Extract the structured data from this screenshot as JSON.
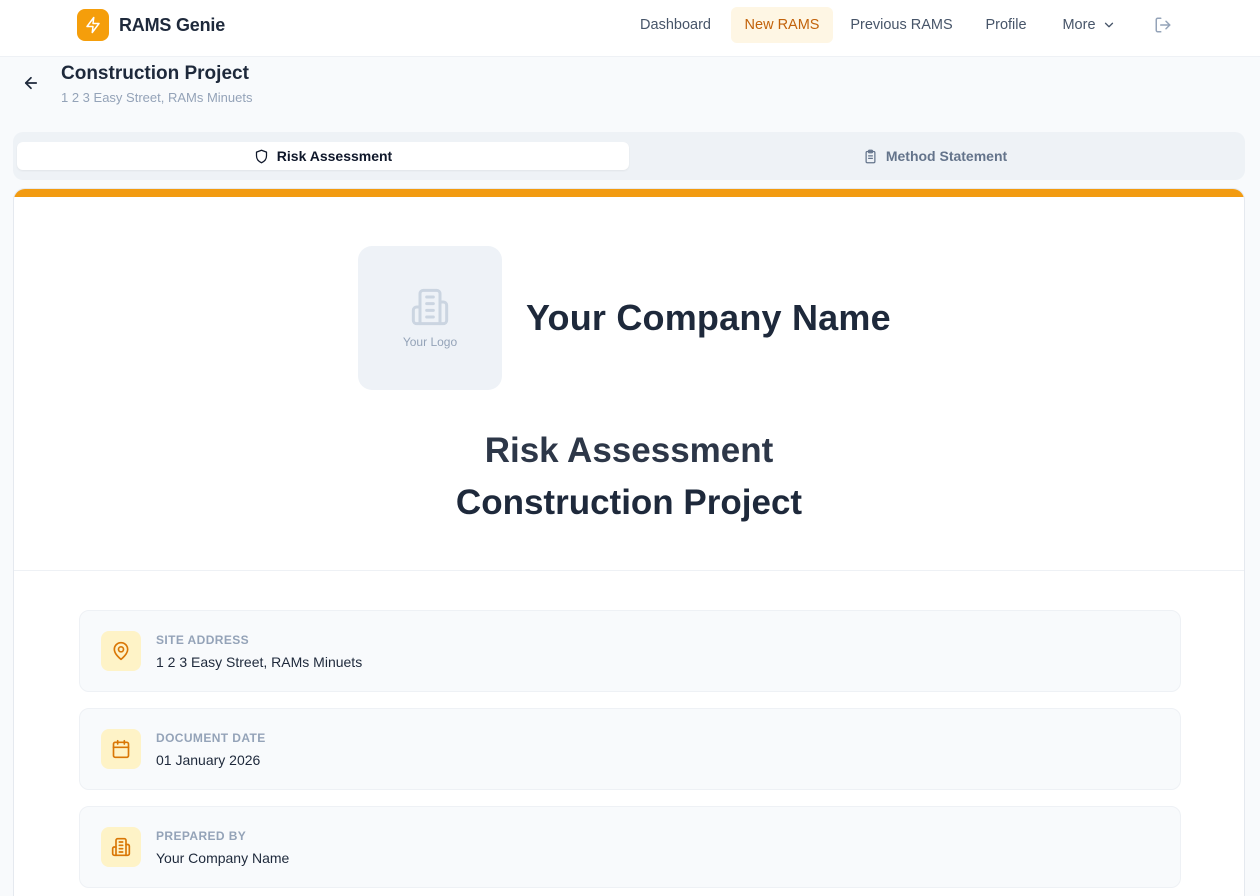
{
  "app": {
    "name": "RAMS Genie",
    "logo_icon": "lightning-icon",
    "accent": "#f59e0b"
  },
  "nav": {
    "items": [
      {
        "label": "Dashboard",
        "active": false
      },
      {
        "label": "New RAMS",
        "active": true
      },
      {
        "label": "Previous RAMS",
        "active": false
      },
      {
        "label": "Profile",
        "active": false
      },
      {
        "label": "More",
        "active": false,
        "icon": "chevron-down-icon"
      }
    ],
    "logout_icon": "logout-icon"
  },
  "project": {
    "title": "Construction Project",
    "address": "1 2 3 Easy Street, RAMs Minuets"
  },
  "tabs": [
    {
      "label": "Risk Assessment",
      "icon": "shield-icon",
      "active": true
    },
    {
      "label": "Method Statement",
      "icon": "clipboard-icon",
      "active": false
    }
  ],
  "document": {
    "logo_placeholder": "Your Logo",
    "company_name": "Your Company Name",
    "title_line1": "Risk Assessment",
    "title_line2": "Construction Project",
    "accent_bar_color": "#f29b11",
    "details": [
      {
        "label": "SITE ADDRESS",
        "value": "1 2 3 Easy Street, RAMs Minuets",
        "icon": "map-pin-icon"
      },
      {
        "label": "DOCUMENT DATE",
        "value": "01 January 2026",
        "icon": "calendar-icon"
      },
      {
        "label": "PREPARED BY",
        "value": "Your Company Name",
        "icon": "building-icon"
      }
    ]
  }
}
